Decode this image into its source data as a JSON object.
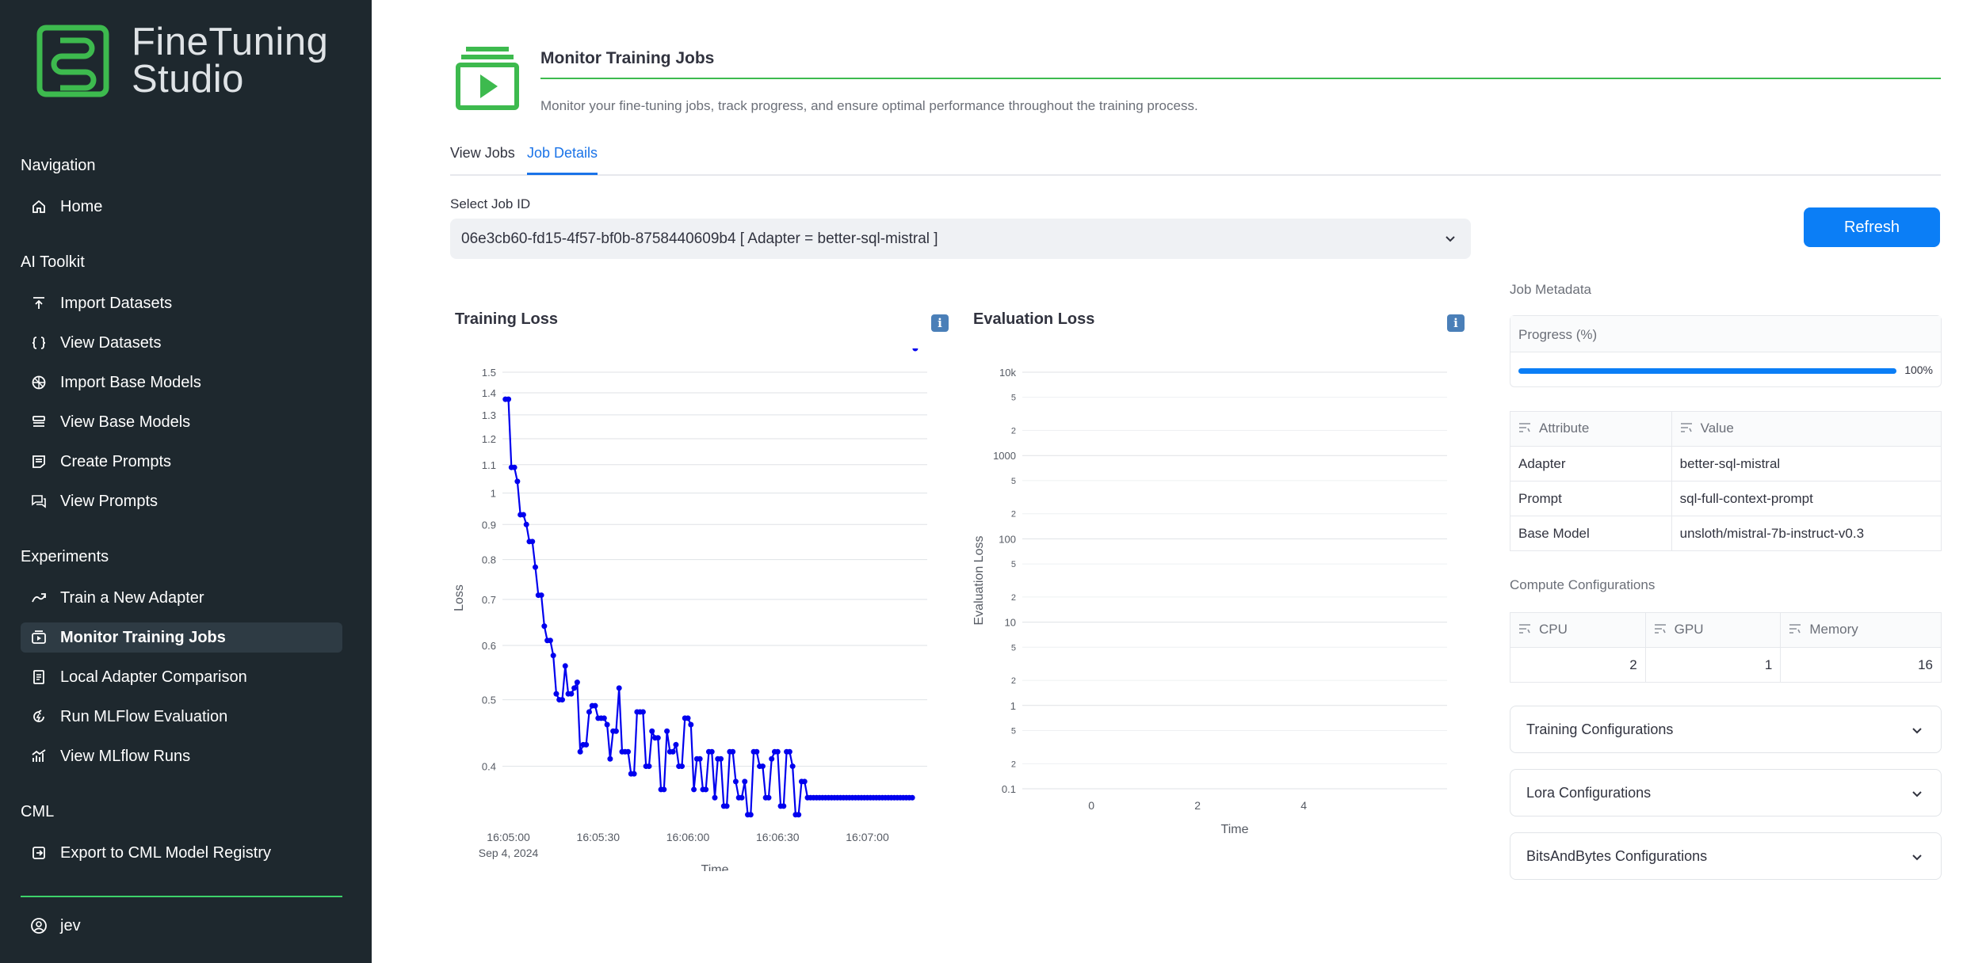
{
  "app": {
    "logo_text_line1": "FineTuning",
    "logo_text_line2": "Studio",
    "accent_color": "#3dba4e",
    "primary_color": "#0b7ef6"
  },
  "sidebar": {
    "sections": [
      {
        "title": "Navigation",
        "items": [
          {
            "label": "Home",
            "icon": "home-icon"
          }
        ]
      },
      {
        "title": "AI Toolkit",
        "items": [
          {
            "label": "Import Datasets",
            "icon": "upload-icon"
          },
          {
            "label": "View Datasets",
            "icon": "braces-icon"
          },
          {
            "label": "Import Base Models",
            "icon": "network-icon"
          },
          {
            "label": "View Base Models",
            "icon": "stack-icon"
          },
          {
            "label": "Create Prompts",
            "icon": "note-icon"
          },
          {
            "label": "View Prompts",
            "icon": "chat-icon"
          }
        ]
      },
      {
        "title": "Experiments",
        "items": [
          {
            "label": "Train a New Adapter",
            "icon": "trend-arrow-icon"
          },
          {
            "label": "Monitor Training Jobs",
            "icon": "monitor-play-icon",
            "active": true
          },
          {
            "label": "Local Adapter Comparison",
            "icon": "compare-doc-icon"
          },
          {
            "label": "Run MLFlow Evaluation",
            "icon": "refresh-bolt-icon"
          },
          {
            "label": "View MLflow Runs",
            "icon": "chart-icon"
          }
        ]
      },
      {
        "title": "CML",
        "items": [
          {
            "label": "Export to CML Model Registry",
            "icon": "export-icon"
          }
        ]
      }
    ],
    "user": "jev"
  },
  "header": {
    "title": "Monitor Training Jobs",
    "subtitle": "Monitor your fine-tuning jobs, track progress, and ensure optimal performance throughout the training process."
  },
  "tabs": [
    {
      "label": "View Jobs",
      "active": false
    },
    {
      "label": "Job Details",
      "active": true
    }
  ],
  "job_select": {
    "label": "Select Job ID",
    "value": "06e3cb60-fd15-4f57-bf0b-8758440609b4 [ Adapter = better-sql-mistral ]"
  },
  "refresh_label": "Refresh",
  "metadata": {
    "label": "Job Metadata",
    "progress_label": "Progress (%)",
    "progress_value": 100,
    "progress_text": "100%",
    "attr_headers": [
      "Attribute",
      "Value"
    ],
    "attributes": [
      [
        "Adapter",
        "better-sql-mistral"
      ],
      [
        "Prompt",
        "sql-full-context-prompt"
      ],
      [
        "Base Model",
        "unsloth/mistral-7b-instruct-v0.3"
      ]
    ],
    "compute_label": "Compute Configurations",
    "compute_headers": [
      "CPU",
      "GPU",
      "Memory"
    ],
    "compute_values": [
      "2",
      "1",
      "16"
    ],
    "expanders": [
      "Training Configurations",
      "Lora Configurations",
      "BitsAndBytes Configurations"
    ]
  },
  "chart_data": [
    {
      "type": "line",
      "title": "Training Loss",
      "xlabel": "Time",
      "ylabel": "Loss",
      "yscale": "log",
      "ylim": [
        0.33,
        1.5
      ],
      "yticks": [
        0.4,
        0.5,
        0.6,
        0.7,
        0.8,
        0.9,
        1,
        1.1,
        1.2,
        1.3,
        1.4,
        1.5
      ],
      "xticks": [
        "16:05:00",
        "16:05:30",
        "16:06:00",
        "16:06:30",
        "16:07:00"
      ],
      "xtick_sub": "Sep 4, 2024",
      "xlim": [
        "16:04:58",
        "16:07:20"
      ],
      "color": "#0000ee",
      "grid": true,
      "x": [
        "16:04:59",
        "16:05:00",
        "16:05:01",
        "16:05:02",
        "16:05:03",
        "16:05:04",
        "16:05:05",
        "16:05:06",
        "16:05:07",
        "16:05:08",
        "16:05:09",
        "16:05:10",
        "16:05:11",
        "16:05:12",
        "16:05:13",
        "16:05:14",
        "16:05:15",
        "16:05:16",
        "16:05:17",
        "16:05:18",
        "16:05:19",
        "16:05:20",
        "16:05:21",
        "16:05:22",
        "16:05:23",
        "16:05:24",
        "16:05:25",
        "16:05:26",
        "16:05:27",
        "16:05:28",
        "16:05:29",
        "16:05:30",
        "16:05:31",
        "16:05:32",
        "16:05:33",
        "16:05:34",
        "16:05:35",
        "16:05:36",
        "16:05:37",
        "16:05:38",
        "16:05:39",
        "16:05:40",
        "16:05:41",
        "16:05:42",
        "16:05:43",
        "16:05:44",
        "16:05:45",
        "16:05:46",
        "16:05:47",
        "16:05:48",
        "16:05:49",
        "16:05:50",
        "16:05:51",
        "16:05:52",
        "16:05:53",
        "16:05:54",
        "16:05:55",
        "16:05:56",
        "16:05:57",
        "16:05:58",
        "16:05:59",
        "16:06:00",
        "16:06:01",
        "16:06:02",
        "16:06:03",
        "16:06:04",
        "16:06:05",
        "16:06:06",
        "16:06:07",
        "16:06:08",
        "16:06:09",
        "16:06:10",
        "16:06:11",
        "16:06:12",
        "16:06:13",
        "16:06:14",
        "16:06:15",
        "16:06:16",
        "16:06:17",
        "16:06:18",
        "16:06:19",
        "16:06:20",
        "16:06:21",
        "16:06:22",
        "16:06:23",
        "16:06:24",
        "16:06:25",
        "16:06:26",
        "16:06:27",
        "16:06:28",
        "16:06:29",
        "16:06:30",
        "16:06:31",
        "16:06:32",
        "16:06:33",
        "16:06:34",
        "16:06:35",
        "16:06:36",
        "16:06:37",
        "16:06:38",
        "16:06:39",
        "16:06:40",
        "16:06:41",
        "16:06:42",
        "16:06:43",
        "16:06:44",
        "16:06:45",
        "16:06:46",
        "16:06:47",
        "16:06:48",
        "16:06:49",
        "16:06:50",
        "16:06:51",
        "16:06:52",
        "16:06:53",
        "16:06:54",
        "16:06:55",
        "16:06:56",
        "16:06:57",
        "16:06:58",
        "16:06:59",
        "16:07:00",
        "16:07:01",
        "16:07:02",
        "16:07:03",
        "16:07:04",
        "16:07:05",
        "16:07:06",
        "16:07:07",
        "16:07:08",
        "16:07:09",
        "16:07:10",
        "16:07:11",
        "16:07:12",
        "16:07:13",
        "16:07:14",
        "16:07:15",
        "16:07:16"
      ],
      "values": [
        1.37,
        1.37,
        1.09,
        1.09,
        1.04,
        0.93,
        0.93,
        0.9,
        0.85,
        0.85,
        0.78,
        0.71,
        0.71,
        0.64,
        0.61,
        0.61,
        0.58,
        0.51,
        0.5,
        0.5,
        0.56,
        0.51,
        0.51,
        0.52,
        0.53,
        0.42,
        0.43,
        0.43,
        0.48,
        0.49,
        0.49,
        0.47,
        0.47,
        0.47,
        0.46,
        0.41,
        0.45,
        0.45,
        0.52,
        0.42,
        0.42,
        0.42,
        0.39,
        0.39,
        0.48,
        0.48,
        0.48,
        0.4,
        0.4,
        0.45,
        0.44,
        0.44,
        0.37,
        0.37,
        0.45,
        0.42,
        0.42,
        0.43,
        0.4,
        0.4,
        0.47,
        0.47,
        0.46,
        0.37,
        0.41,
        0.41,
        0.37,
        0.37,
        0.42,
        0.42,
        0.36,
        0.41,
        0.41,
        0.35,
        0.35,
        0.42,
        0.42,
        0.38,
        0.36,
        0.36,
        0.38,
        0.34,
        0.34,
        0.42,
        0.42,
        0.4,
        0.4,
        0.36,
        0.36,
        0.41,
        0.42,
        0.42,
        0.35,
        0.35,
        0.42,
        0.42,
        0.4,
        0.34,
        0.34,
        0.38,
        0.38,
        0.36,
        0.36,
        0.36,
        0.36,
        0.36,
        0.36,
        0.36,
        0.36,
        0.36,
        0.36,
        0.36,
        0.36,
        0.36,
        0.36,
        0.36,
        0.36,
        0.36,
        0.36,
        0.36,
        0.36,
        0.36,
        0.36,
        0.36,
        0.36,
        0.36,
        0.36,
        0.36,
        0.36,
        0.36,
        0.36,
        0.36,
        0.36,
        0.36,
        0.36,
        0.36,
        0.36
      ]
    },
    {
      "type": "line",
      "title": "Evaluation Loss",
      "xlabel": "Time",
      "ylabel": "Evaluation Loss",
      "yscale": "log",
      "ylim": [
        0.1,
        10000
      ],
      "ytick_major": [
        "0.1",
        "1",
        "10",
        "100",
        "1000",
        "10k"
      ],
      "ytick_minor": [
        "2",
        "5"
      ],
      "xticks": [
        "0",
        "2",
        "4"
      ],
      "xlim": [
        -1.3,
        6.7
      ],
      "grid": true,
      "values": []
    }
  ]
}
